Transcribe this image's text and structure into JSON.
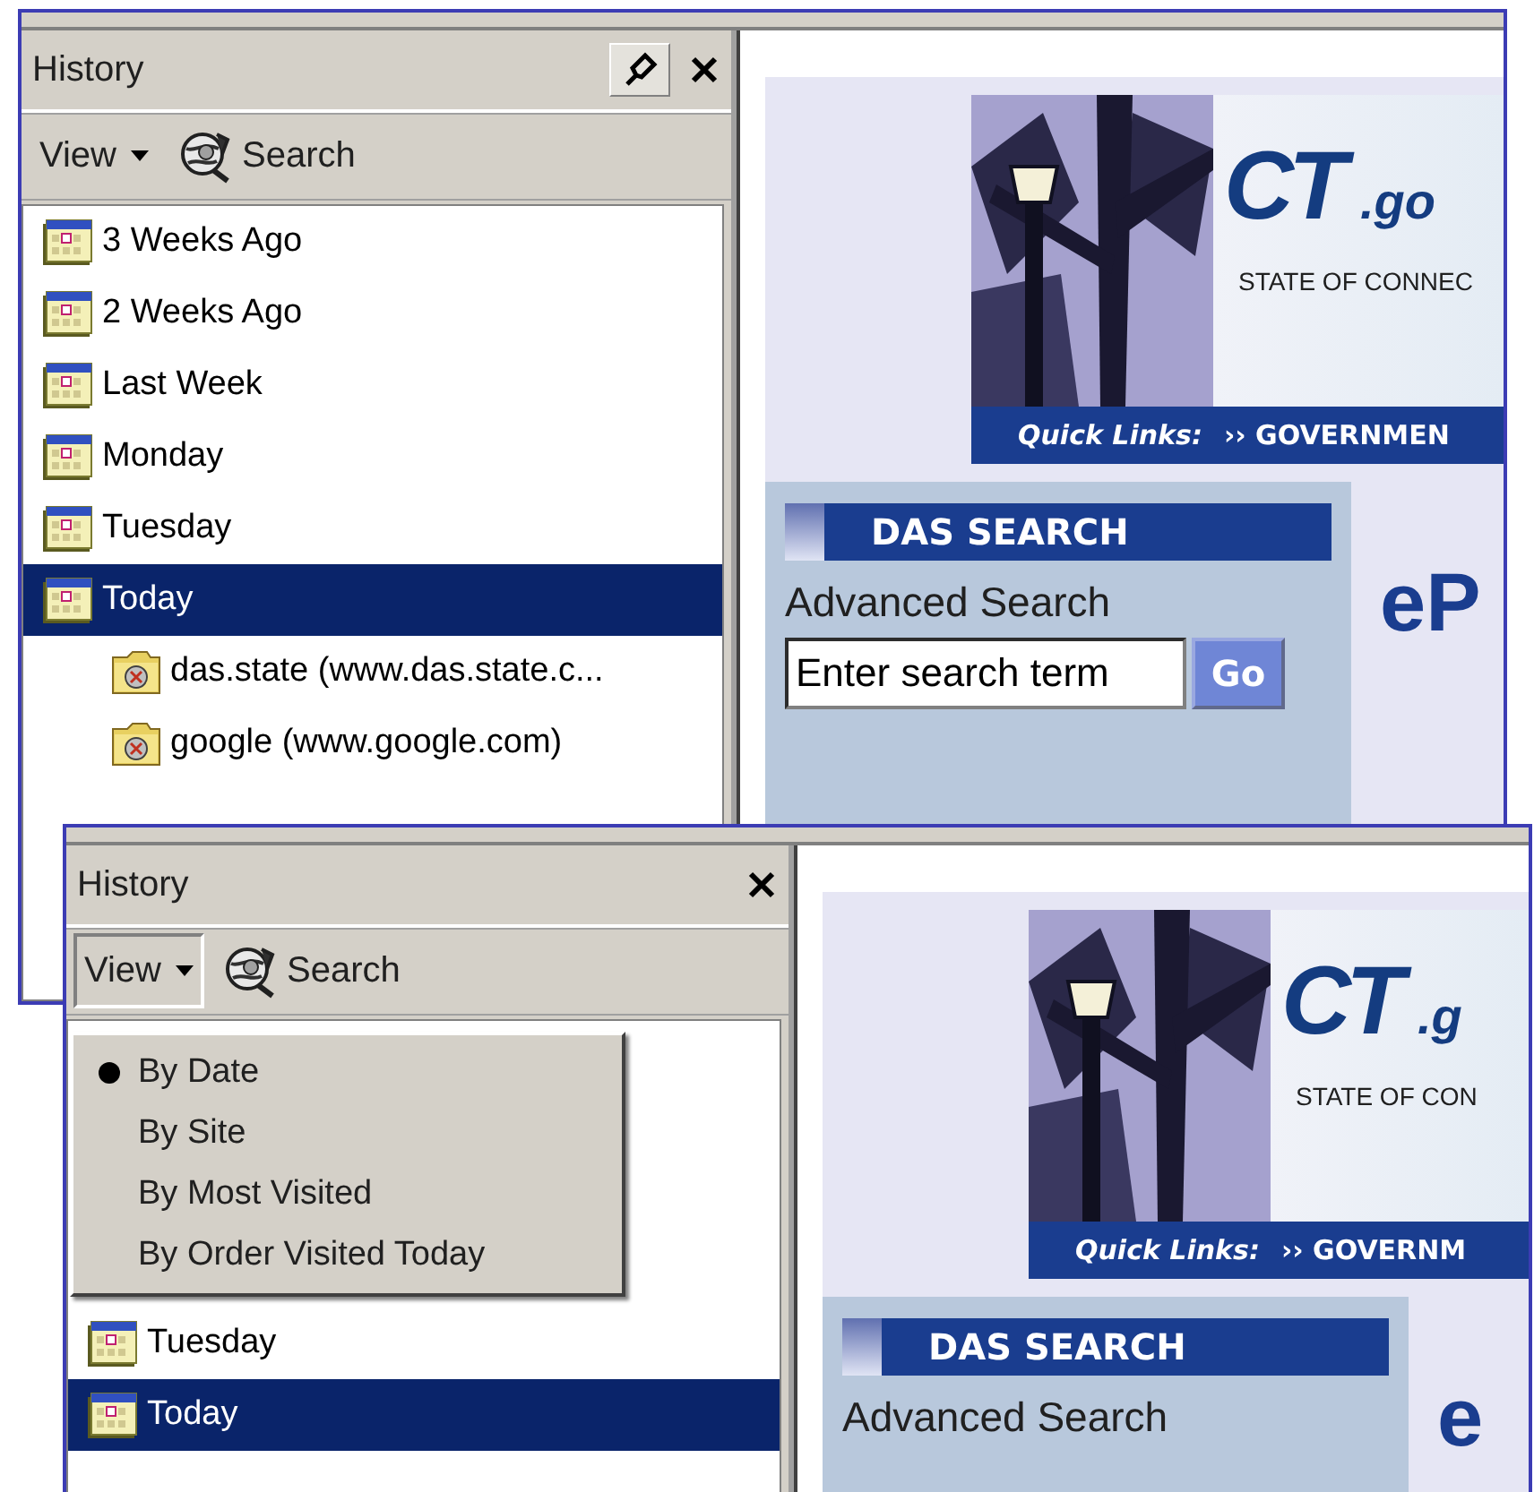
{
  "windows": [
    {
      "history": {
        "title": "History",
        "pin_button": true,
        "view_button": {
          "label": "View",
          "pressed": false
        },
        "search_button": "Search",
        "items": [
          {
            "label": "3 Weeks Ago",
            "selected": false
          },
          {
            "label": "2 Weeks Ago",
            "selected": false
          },
          {
            "label": "Last Week",
            "selected": false
          },
          {
            "label": "Monday",
            "selected": false
          },
          {
            "label": "Tuesday",
            "selected": false
          },
          {
            "label": "Today",
            "selected": true,
            "children": [
              {
                "label": "das.state (www.das.state.c...",
                "selected": false
              },
              {
                "label": "google (www.google.com)",
                "selected": false
              }
            ]
          }
        ]
      },
      "page": {
        "banner": {
          "logo": "CT",
          "logo_suffix": ".go",
          "tagline": "STATE OF CONNEC",
          "quick_links": "Quick Links:",
          "quick_link": "›› GOVERNMEN"
        },
        "search_panel": {
          "header": "DAS SEARCH",
          "label": "Advanced Search",
          "field_value": "Enter search term",
          "go": "Go"
        },
        "heading": "eP"
      }
    },
    {
      "history": {
        "title": "History",
        "view_button": {
          "label": "View",
          "pressed": true
        },
        "search_button": "Search",
        "view_menu": [
          {
            "label": "By Date",
            "selected": true
          },
          {
            "label": "By Site",
            "selected": false
          },
          {
            "label": "By Most Visited",
            "selected": false
          },
          {
            "label": "By Order Visited Today",
            "selected": false
          }
        ],
        "items": [
          {
            "label": "Tuesday",
            "selected": false
          },
          {
            "label": "Today",
            "selected": true
          }
        ]
      },
      "page": {
        "banner": {
          "logo": "CT",
          "logo_suffix": ".g",
          "tagline": "STATE OF CON",
          "quick_links": "Quick Links:",
          "quick_link": "›› GOVERNM"
        },
        "search_panel": {
          "header": "DAS SEARCH",
          "label": "Advanced Search"
        },
        "heading": "e"
      }
    }
  ]
}
